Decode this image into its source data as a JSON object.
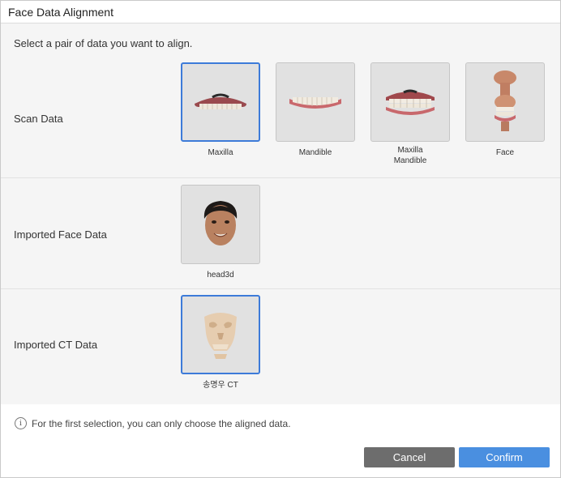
{
  "dialog": {
    "title": "Face Data Alignment",
    "instruction": "Select a pair of data you want to align."
  },
  "rows": [
    {
      "label": "Scan Data",
      "items": [
        {
          "caption": "Maxilla",
          "selected": true,
          "icon": "maxilla-teeth-icon"
        },
        {
          "caption": "Mandible",
          "selected": false,
          "icon": "mandible-teeth-icon"
        },
        {
          "caption": "Maxilla\nMandible",
          "selected": false,
          "icon": "maxilla-mandible-teeth-icon"
        },
        {
          "caption": "Face",
          "selected": false,
          "icon": "face-scan-icon"
        }
      ]
    },
    {
      "label": "Imported Face Data",
      "items": [
        {
          "caption": "head3d",
          "selected": false,
          "icon": "head-3d-icon"
        }
      ]
    },
    {
      "label": "Imported CT Data",
      "items": [
        {
          "caption": "송명우 CT",
          "selected": true,
          "icon": "ct-skull-icon"
        }
      ]
    }
  ],
  "footer": {
    "info_icon": "i",
    "info_text": "For the first selection, you can only choose the aligned data.",
    "cancel_label": "Cancel",
    "confirm_label": "Confirm"
  },
  "colors": {
    "selected_border": "#3d7bd9",
    "confirm": "#4a8fe0",
    "cancel": "#6d6d6d"
  }
}
